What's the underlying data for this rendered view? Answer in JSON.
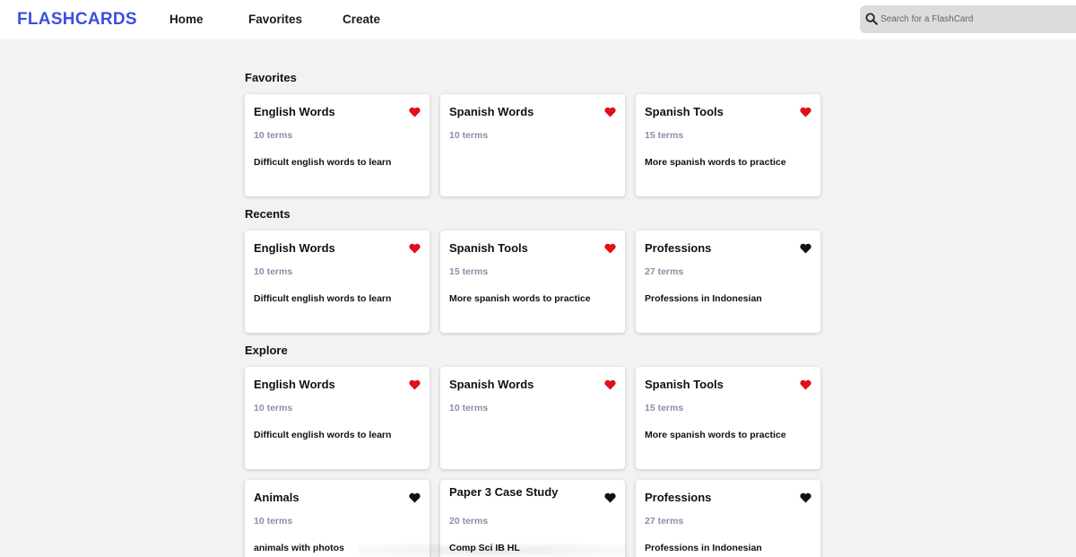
{
  "brand": "FLASHCARDS",
  "nav": [
    "Home",
    "Favorites",
    "Create"
  ],
  "search": {
    "placeholder": "Search for a FlashCard",
    "value": ""
  },
  "colors": {
    "brand": "#3b4fe0",
    "heart_active": "#e0101a",
    "heart_inactive": "#111111",
    "terms": "#8a8fa8"
  },
  "sections": [
    {
      "title": "Favorites",
      "cards": [
        {
          "title": "English Words",
          "terms": "10 terms",
          "desc": "Difficult english words to learn",
          "favorite": true,
          "icon": "heart-icon"
        },
        {
          "title": "Spanish Words",
          "terms": "10 terms",
          "desc": "",
          "favorite": true,
          "icon": "heart-icon"
        },
        {
          "title": "Spanish Tools",
          "terms": "15 terms",
          "desc": "More spanish words to practice",
          "favorite": true,
          "icon": "heart-icon"
        }
      ]
    },
    {
      "title": "Recents",
      "cards": [
        {
          "title": "English Words",
          "terms": "10 terms",
          "desc": "Difficult english words to learn",
          "favorite": true,
          "icon": "heart-icon"
        },
        {
          "title": "Spanish Tools",
          "terms": "15 terms",
          "desc": "More spanish words to practice",
          "favorite": true,
          "icon": "heart-icon"
        },
        {
          "title": "Professions",
          "terms": "27 terms",
          "desc": "Professions in Indonesian",
          "favorite": false,
          "icon": "heart-icon"
        }
      ]
    },
    {
      "title": "Explore",
      "cards": [
        {
          "title": "English Words",
          "terms": "10 terms",
          "desc": "Difficult english words to learn",
          "favorite": true,
          "icon": "heart-icon"
        },
        {
          "title": "Spanish Words",
          "terms": "10 terms",
          "desc": "",
          "favorite": true,
          "icon": "heart-icon"
        },
        {
          "title": "Spanish Tools",
          "terms": "15 terms",
          "desc": "More spanish words to practice",
          "favorite": true,
          "icon": "heart-icon"
        },
        {
          "title": "Animals",
          "terms": "10 terms",
          "desc": "animals with photos",
          "favorite": false,
          "icon": "heart-icon"
        },
        {
          "title": "Paper 3 Case Study",
          "terms": "20 terms",
          "desc": "Comp Sci IB HL",
          "favorite": false,
          "icon": "heart-icon"
        },
        {
          "title": "Professions",
          "terms": "27 terms",
          "desc": "Professions in Indonesian",
          "favorite": false,
          "icon": "heart-icon"
        }
      ]
    }
  ]
}
